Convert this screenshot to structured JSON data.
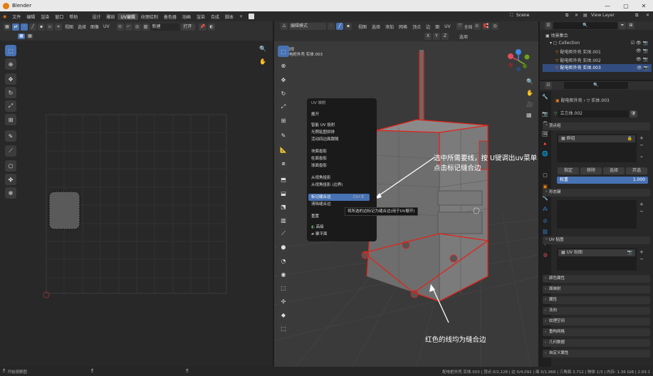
{
  "window": {
    "title": "Blender",
    "controls": [
      "—",
      "▢",
      "✕"
    ]
  },
  "menu": {
    "items": [
      "文件",
      "编辑",
      "渲染",
      "窗口",
      "帮助"
    ],
    "tabs": [
      "Layout",
      "Modeling",
      "Sculpting",
      "UV Editing",
      "Texture Paint",
      "Shading",
      "Animation",
      "Rendering",
      "Compositing",
      "Scripting"
    ],
    "tab_labels": [
      "设计",
      "雕刻",
      "UV编辑",
      "纹理绘制",
      "着色器",
      "动画",
      "渲染",
      "合成",
      "脚本"
    ],
    "add_tab": "+",
    "scene": "Scene",
    "view_layer": "View Layer"
  },
  "uv_header": {
    "items": [
      "视图",
      "选择",
      "图像",
      "UV"
    ],
    "new_button": "新建",
    "open_button": "打开"
  },
  "vp_header": {
    "mode": "编辑模式",
    "items": [
      "视图",
      "选择",
      "添加",
      "网格",
      "顶点",
      "边",
      "面",
      "UV"
    ],
    "orientation": "全局",
    "options": "选项"
  },
  "viewport": {
    "view_name": "用户透视",
    "object_name": "(0) 配电柜外壳 实体.003"
  },
  "uv_menu": {
    "title": "UV 映射",
    "items": [
      {
        "label": "展开",
        "shortcut": ""
      },
      {
        "label": "智能 UV 投射",
        "shortcut": ""
      },
      {
        "label": "光照贴图拼排",
        "shortcut": ""
      },
      {
        "label": "活动四边面跟随",
        "shortcut": ""
      },
      {
        "label": "块面投影",
        "shortcut": ""
      },
      {
        "label": "柱面投影",
        "shortcut": ""
      },
      {
        "label": "球面投影",
        "shortcut": ""
      },
      {
        "label": "从视角投影",
        "shortcut": ""
      },
      {
        "label": "从视角投影 (边界)",
        "shortcut": ""
      },
      {
        "label": "标记缝合边",
        "shortcut": "Ctrl E"
      },
      {
        "label": "清除缝合边",
        "shortcut": ""
      },
      {
        "label": "重置",
        "shortcut": ""
      },
      {
        "label": "高级",
        "shortcut": ""
      },
      {
        "label": "聚平面",
        "shortcut": ""
      }
    ],
    "tooltip": "将所选的边标记为缝合边(用于UV展开)"
  },
  "annotations": {
    "line1": "选中所需要线，按 U键调出uv菜单",
    "line2": "点击标记缝合边",
    "line3": "红色的线均为缝合边"
  },
  "outliner": {
    "title": "场景集合",
    "collection": "Collection",
    "objects": [
      "配电柜外壳 实体.001",
      "配电柜外壳 实体.002",
      "配电柜外壳 实体.003"
    ]
  },
  "properties": {
    "object": "配电柜外壳",
    "mesh_path": "实体.003",
    "data_name": "立方体.002",
    "vertex_groups": "顶点组",
    "vgroup_item": "群组",
    "shape_keys": "形态键",
    "uv_maps": "UV 贴图",
    "uv_map_item": "UV 贴图",
    "assign": "指定",
    "remove": "移除",
    "select": "选择",
    "deselect": "弃选",
    "weight_label": "权重",
    "weight_value": "1.000",
    "panels": [
      "颜色属性",
      "面映射",
      "属性",
      "法向",
      "纹理空间",
      "重构网格",
      "几何数据",
      "自定义属性"
    ]
  },
  "statusbar": {
    "left": "开始观察图",
    "stats": "配电柜外壳 实体.003 | 顶点 0/2,128 | 边 0/4,092 | 面 0/1,968 | 三角面 3,712 | 物体 1/3 | 内存: 1.36 GiB | 2.93.1"
  },
  "colors": {
    "accent": "#4772b3",
    "seam": "#e3221a",
    "mesh": "#7d7d7d",
    "gizmo_x": "#e24c5c",
    "gizmo_y": "#7dbb1c",
    "gizmo_z": "#3e8ae6"
  }
}
